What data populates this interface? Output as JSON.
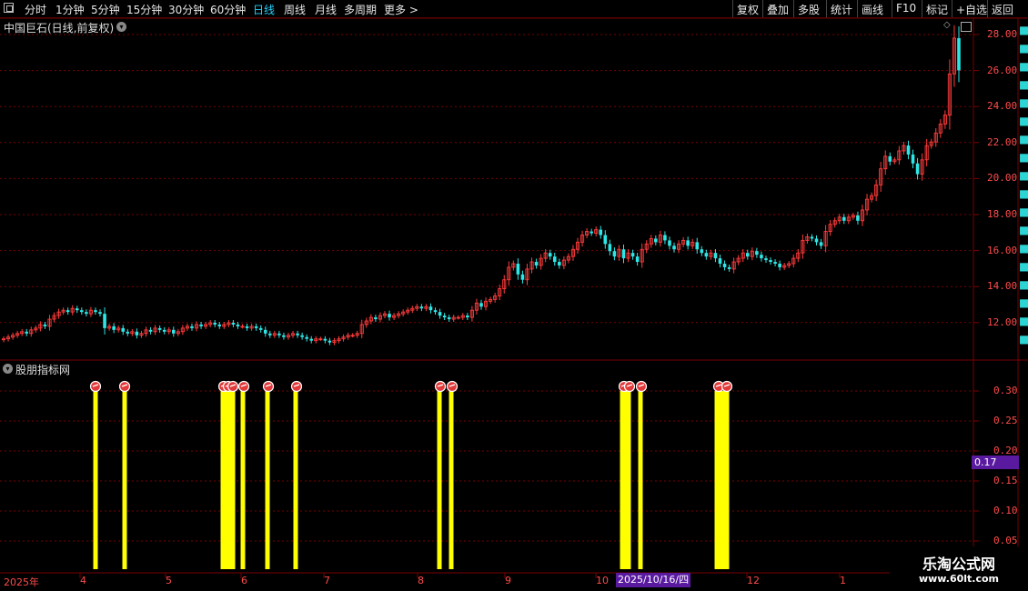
{
  "toolbar": {
    "left_items": [
      {
        "label": "分时",
        "active": false
      },
      {
        "label": "1分钟",
        "active": false
      },
      {
        "label": "5分钟",
        "active": false
      },
      {
        "label": "15分钟",
        "active": false
      },
      {
        "label": "30分钟",
        "active": false
      },
      {
        "label": "60分钟",
        "active": false
      },
      {
        "label": "日线",
        "active": true
      },
      {
        "label": "周线",
        "active": false
      },
      {
        "label": "月线",
        "active": false
      },
      {
        "label": "多周期",
        "active": false
      },
      {
        "label": "更多 >",
        "active": false
      }
    ],
    "right_items": [
      "复权",
      "叠加",
      "多股",
      "统计",
      "画线",
      "F10",
      "标记",
      "+自选",
      "返回"
    ]
  },
  "stock": {
    "title": "中国巨石(日线,前复权)"
  },
  "price_axis": [
    "28.00",
    "26.00",
    "24.00",
    "22.00",
    "20.00",
    "18.00",
    "16.00",
    "14.00",
    "12.00"
  ],
  "indicator": {
    "title": "股朋指标网",
    "axis": [
      "0.30",
      "0.25",
      "0.20",
      "0.15",
      "0.10",
      "0.05"
    ],
    "current_value": "0.17"
  },
  "time_axis": {
    "labels": [
      "2025年",
      "4",
      "5",
      "6",
      "7",
      "8",
      "9",
      "10",
      "12",
      "1"
    ],
    "cursor_date": "2025/10/16/四"
  },
  "watermark": {
    "title": "乐淘公式网",
    "url": "www.60lt.com"
  },
  "colors": {
    "up": "#ff3b3b",
    "down": "#2ee6e6",
    "signal_bar": "#ffff00",
    "grid": "#7a0000",
    "axis_text": "#ff4b4b",
    "active_tab": "#21d4ff",
    "badge": "#5a1aa0"
  },
  "chart_data": {
    "type": "candlestick",
    "ylim": [
      10.0,
      29.0
    ],
    "closes": [
      11.0,
      11.1,
      11.2,
      11.3,
      11.4,
      11.3,
      11.5,
      11.6,
      11.8,
      11.7,
      12.1,
      12.3,
      12.5,
      12.6,
      12.5,
      12.7,
      12.6,
      12.5,
      12.4,
      12.6,
      12.5,
      12.4,
      11.6,
      11.7,
      11.5,
      11.6,
      11.4,
      11.3,
      11.4,
      11.2,
      11.3,
      11.5,
      11.4,
      11.6,
      11.5,
      11.4,
      11.5,
      11.3,
      11.4,
      11.6,
      11.7,
      11.6,
      11.8,
      11.7,
      11.8,
      11.9,
      11.8,
      11.7,
      11.8,
      11.9,
      11.8,
      11.7,
      11.7,
      11.6,
      11.7,
      11.6,
      11.5,
      11.3,
      11.2,
      11.3,
      11.2,
      11.1,
      11.2,
      11.3,
      11.2,
      11.1,
      11.0,
      10.9,
      11.0,
      11.0,
      10.9,
      10.8,
      10.9,
      11.0,
      11.1,
      11.2,
      11.2,
      11.3,
      11.8,
      12.0,
      12.2,
      12.1,
      12.3,
      12.4,
      12.2,
      12.3,
      12.4,
      12.5,
      12.6,
      12.7,
      12.8,
      12.7,
      12.8,
      12.6,
      12.5,
      12.3,
      12.2,
      12.1,
      12.2,
      12.2,
      12.3,
      12.2,
      12.6,
      13.0,
      12.8,
      13.1,
      13.2,
      13.4,
      13.8,
      14.3,
      15.0,
      15.2,
      14.6,
      14.3,
      14.9,
      15.3,
      15.1,
      15.5,
      15.8,
      15.6,
      15.3,
      15.1,
      15.4,
      15.6,
      16.0,
      16.4,
      16.8,
      17.0,
      16.9,
      17.1,
      16.8,
      16.3,
      15.9,
      15.6,
      16.0,
      15.5,
      15.8,
      15.6,
      15.3,
      16.0,
      16.3,
      16.6,
      16.4,
      16.8,
      16.5,
      16.2,
      16.0,
      16.3,
      16.5,
      16.2,
      16.4,
      16.0,
      15.8,
      15.6,
      15.8,
      15.5,
      15.2,
      15.0,
      14.9,
      15.3,
      15.5,
      15.8,
      15.6,
      15.9,
      15.7,
      15.5,
      15.4,
      15.3,
      15.2,
      15.0,
      15.1,
      15.2,
      15.5,
      15.8,
      16.5,
      16.7,
      16.6,
      16.4,
      16.2,
      17.0,
      17.4,
      17.6,
      17.8,
      17.6,
      17.8,
      17.9,
      17.6,
      18.2,
      18.8,
      19.0,
      19.6,
      20.5,
      21.2,
      20.9,
      21.0,
      21.5,
      21.8,
      21.3,
      20.8,
      20.2,
      21.0,
      21.8,
      22.0,
      22.5,
      23.0,
      23.5,
      25.8,
      27.8,
      26.0
    ]
  }
}
